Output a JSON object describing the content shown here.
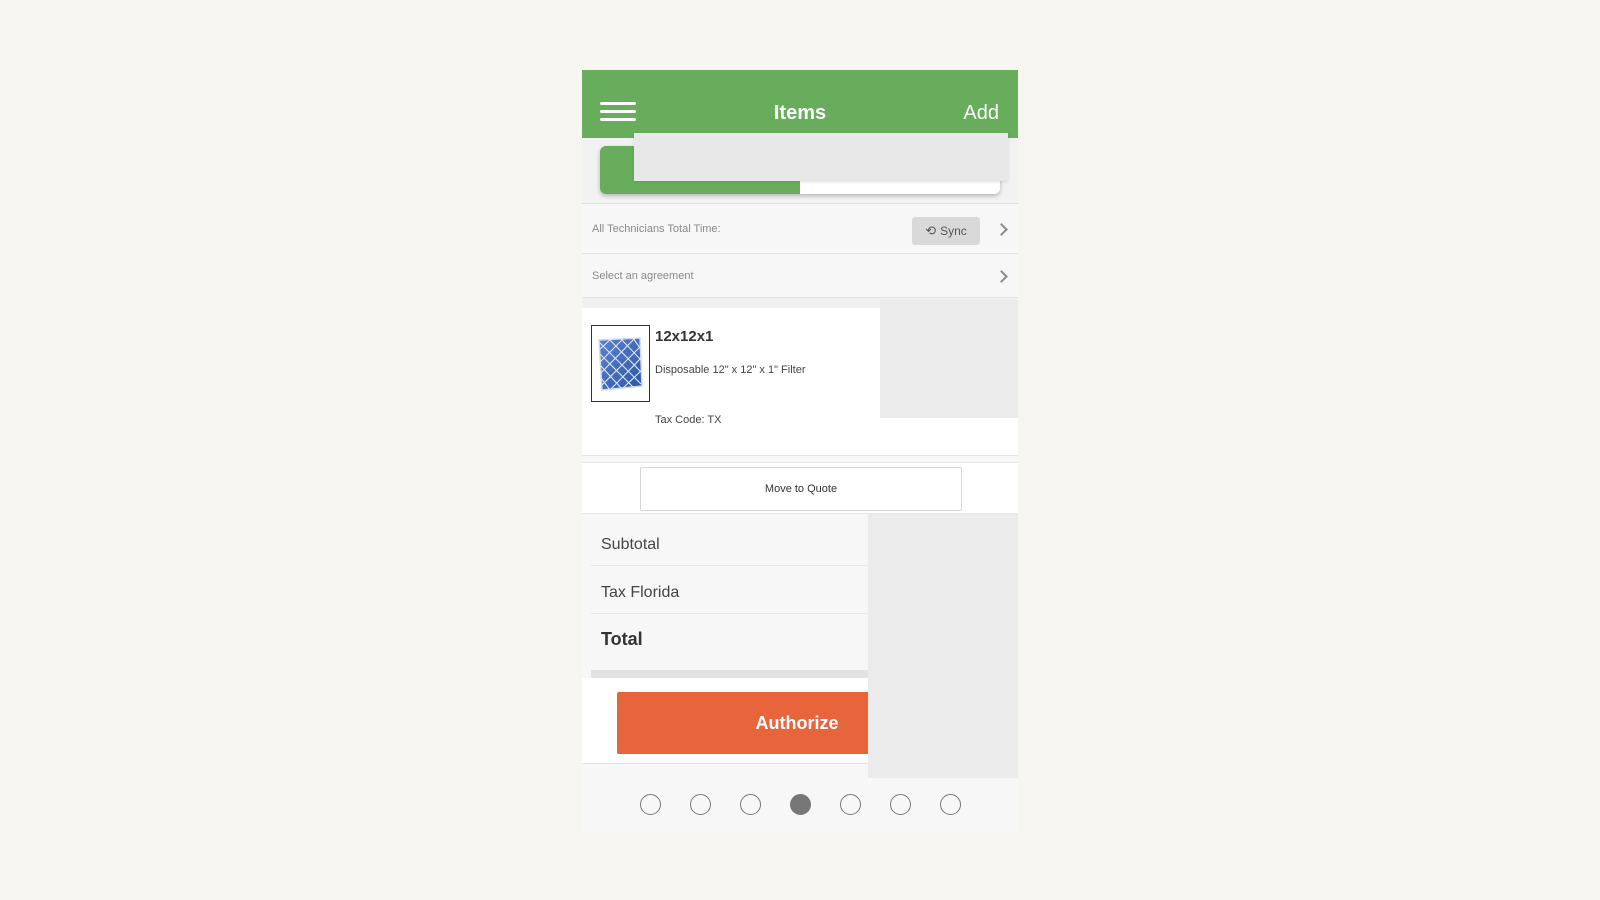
{
  "header": {
    "title": "Items",
    "add_label": "Add",
    "menu_icon": "hamburger-menu-icon",
    "color": "#67ad5b"
  },
  "segment": {
    "left_label": "",
    "right_label": ""
  },
  "time_row": {
    "label": "All Technicians Total Time:",
    "sync_label": "Sync",
    "sync_icon": "sync-icon"
  },
  "agreement_row": {
    "label": "Select an agreement"
  },
  "item": {
    "name": "12x12x1",
    "description": "Disposable 12\" x 12\" x 1\" Filter",
    "tax_code": "Tax Code: TX",
    "thumbnail_icon": "air-filter-icon"
  },
  "move_button": {
    "label": "Move to Quote"
  },
  "totals": {
    "subtotal_label": "Subtotal",
    "tax_label": "Tax Florida",
    "total_label": "Total"
  },
  "authorize": {
    "label": "Authorize",
    "color": "#e8643a"
  },
  "pager": {
    "count": 7,
    "active_index": 3
  }
}
